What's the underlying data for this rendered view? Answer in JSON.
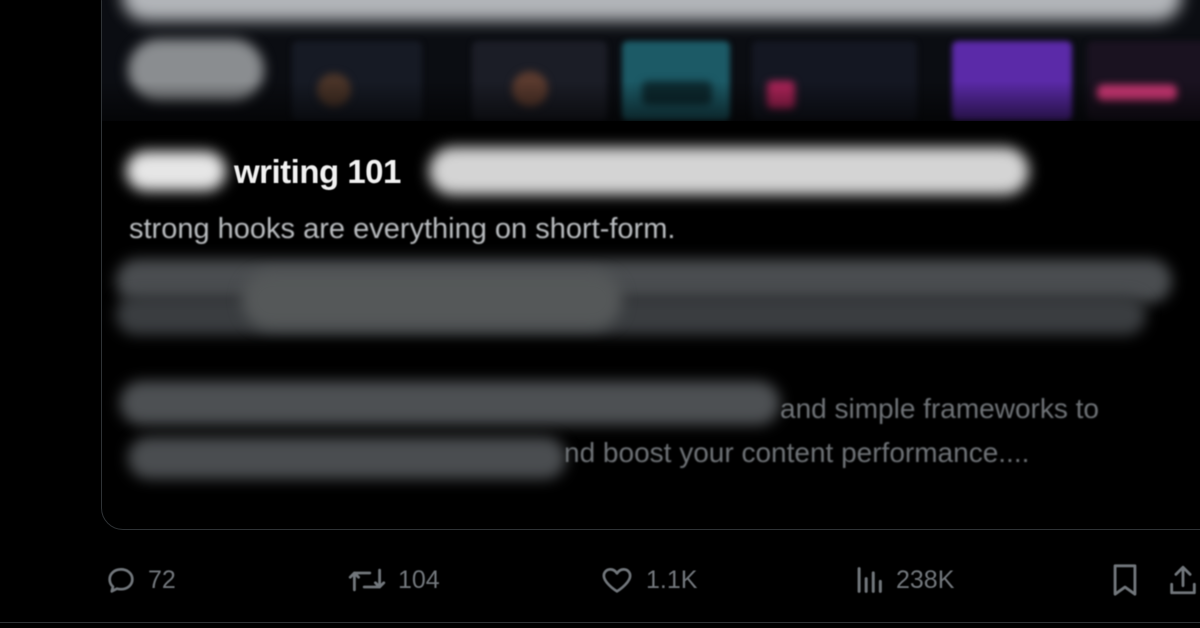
{
  "post_card": {
    "title": "writing 101",
    "subtitle": "strong hooks are everything on short-form.",
    "paragraph_line_1": "and simple frameworks to",
    "paragraph_line_2": "nd boost your content performance...."
  },
  "actions": {
    "replies": "72",
    "reposts": "104",
    "likes": "1.1K",
    "views": "238K"
  },
  "icons": {
    "reply": "reply-icon",
    "repost": "repost-icon",
    "like": "heart-icon",
    "views": "views-icon",
    "bookmark": "bookmark-icon",
    "share": "share-icon"
  },
  "colors": {
    "background": "#000000",
    "text_primary": "#f2f2f2",
    "text_secondary": "#71767b",
    "border": "#2f3336"
  }
}
